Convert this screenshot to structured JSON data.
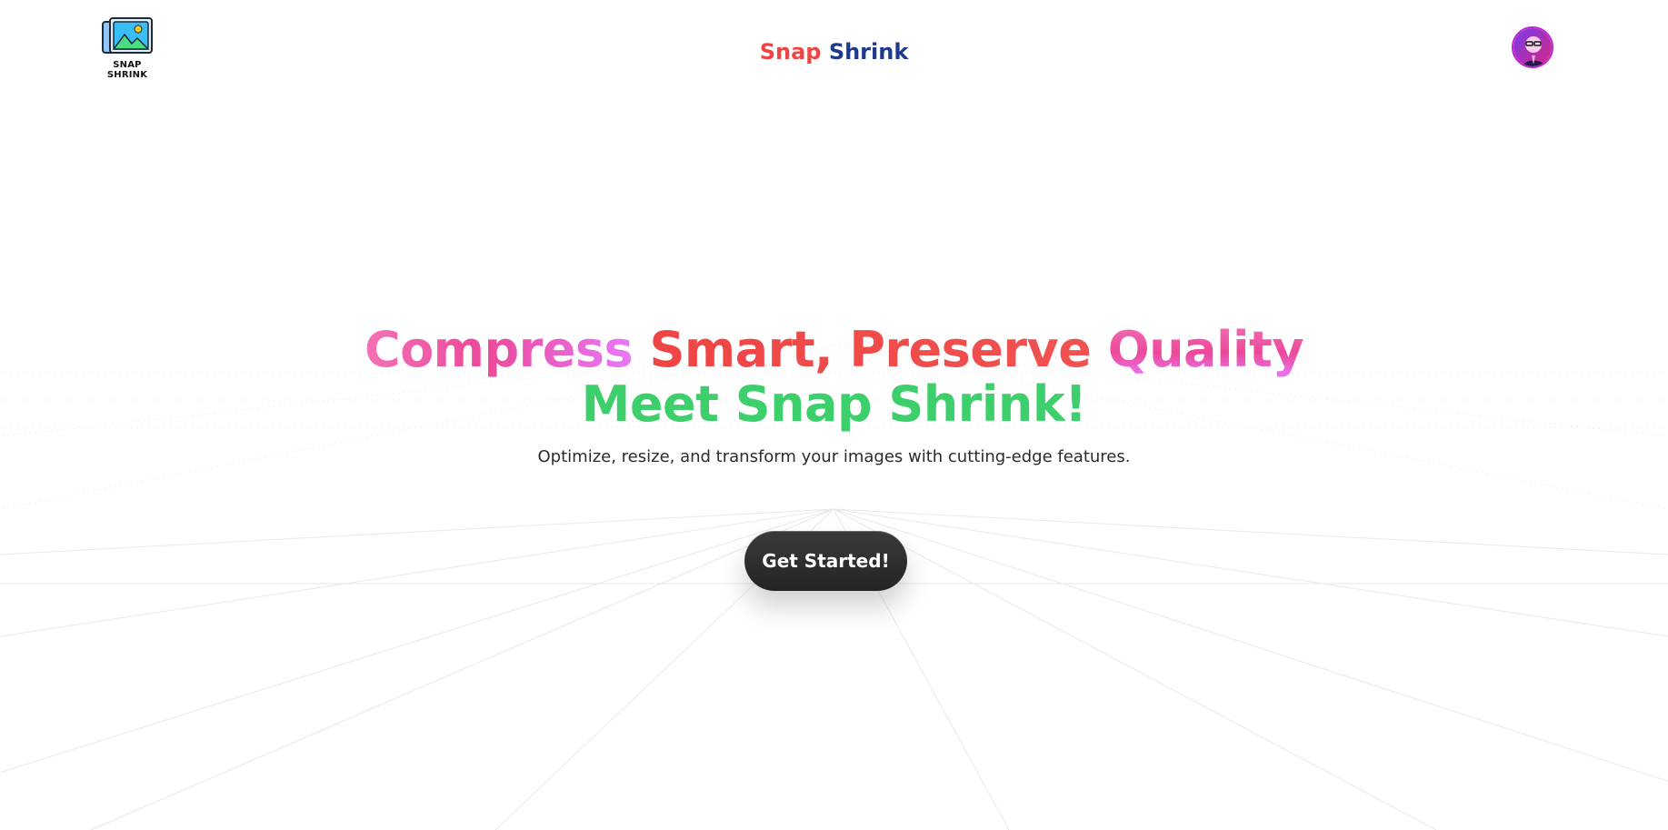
{
  "header": {
    "logo_text": "SNAP\nSHRINK",
    "logo_line1": "SNAP",
    "logo_line2": "SHRINK",
    "brand_word1": "Snap",
    "brand_word2": "Shrink",
    "logo_icon": "image-stack-icon",
    "avatar_icon": "user-avatar"
  },
  "hero": {
    "headline_word1": "Compress",
    "headline_word2": "Smart, Preserve",
    "headline_word3": "Quality",
    "headline_line2": "Meet Snap Shrink!",
    "subtitle": "Optimize, resize, and transform your images with cutting-edge features.",
    "cta_label": "Get Started!"
  },
  "colors": {
    "brand_red": "#ef4444",
    "brand_navy": "#1e3a8a",
    "headline_pink": "#ec4899",
    "headline_green": "#3ccf6b",
    "button_dark": "#2b2b2b"
  }
}
